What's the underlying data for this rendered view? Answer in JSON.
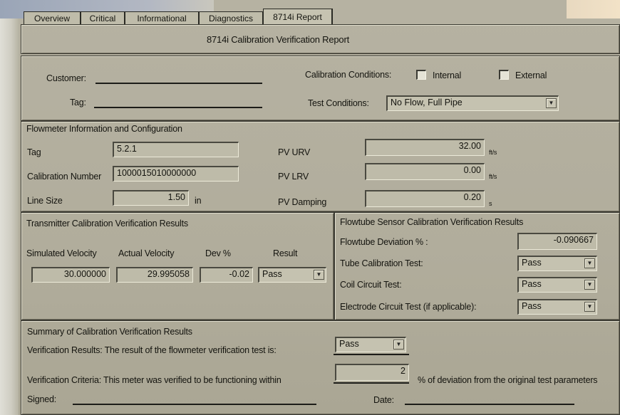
{
  "tabs": [
    {
      "label": "Overview"
    },
    {
      "label": "Critical"
    },
    {
      "label": "Informational"
    },
    {
      "label": "Diagnostics"
    },
    {
      "label": "8714i Report",
      "active": true
    }
  ],
  "report_title": "8714i Calibration Verification Report",
  "header": {
    "customer_label": "Customer:",
    "tag_label": "Tag:",
    "calibration_conditions_label": "Calibration Conditions:",
    "internal_label": "Internal",
    "external_label": "External",
    "internal_checked": false,
    "external_checked": false,
    "test_conditions_label": "Test Conditions:",
    "test_conditions_value": "No Flow, Full Pipe"
  },
  "flowmeter": {
    "section_title": "Flowmeter Information and Configuration",
    "tag_label": "Tag",
    "tag_value": "5.2.1",
    "cal_number_label": "Calibration Number",
    "cal_number_value": "1000015010000000",
    "line_size_label": "Line Size",
    "line_size_value": "1.50",
    "line_size_unit": "in",
    "pv_urv_label": "PV URV",
    "pv_urv_value": "32.00",
    "pv_urv_unit": "ft/s",
    "pv_lrv_label": "PV LRV",
    "pv_lrv_value": "0.00",
    "pv_lrv_unit": "ft/s",
    "pv_damping_label": "PV Damping",
    "pv_damping_value": "0.20",
    "pv_damping_unit": "s"
  },
  "transmitter": {
    "section_title": "Transmitter Calibration Verification Results",
    "col_simulated": "Simulated Velocity",
    "col_actual": "Actual Velocity",
    "col_dev": "Dev %",
    "col_result": "Result",
    "simulated_value": "30.000000",
    "actual_value": "29.995058",
    "dev_value": "-0.02",
    "result_value": "Pass"
  },
  "flowtube": {
    "section_title": "Flowtube Sensor Calibration Verification Results",
    "deviation_label": "Flowtube Deviation % :",
    "deviation_value": "-0.090667",
    "tube_cal_label": "Tube Calibration Test:",
    "tube_cal_value": "Pass",
    "coil_label": "Coil Circuit Test:",
    "coil_value": "Pass",
    "electrode_label": "Electrode Circuit Test (if applicable):",
    "electrode_value": "Pass"
  },
  "summary": {
    "section_title": "Summary of Calibration Verification Results",
    "verification_results_text": "Verification Results:  The result of the flowmeter verification test is:",
    "verification_results_value": "Pass",
    "criteria_text": "Verification Criteria:  This meter was verified to be functioning within",
    "criteria_value": "2",
    "criteria_suffix": "% of deviation from the original test parameters",
    "signed_label": "Signed:",
    "date_label": "Date:"
  }
}
